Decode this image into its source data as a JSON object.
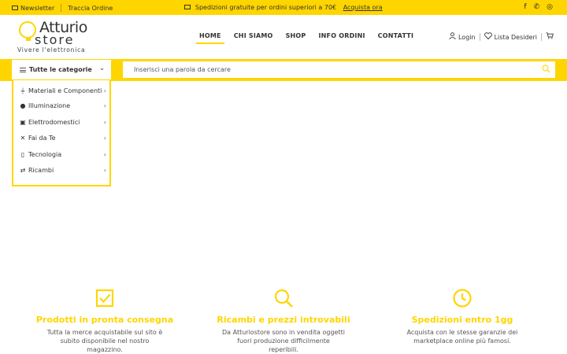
{
  "topbar": {
    "newsletter": "Newsletter",
    "track_order": "Traccia Ordine",
    "shipping_text": "Spedizioni gratuite per ordini superiori a 70€",
    "shipping_link": "Acquista ora",
    "social_icons": [
      "facebook-icon",
      "whatsapp-icon",
      "instagram-icon"
    ]
  },
  "logo": {
    "line1": "Atturio",
    "line2": "store",
    "tagline": "Vivere l'elettronica"
  },
  "nav": {
    "items": [
      "HOME",
      "CHI SIAMO",
      "SHOP",
      "INFO ORDINI",
      "CONTATTI"
    ],
    "active": "HOME"
  },
  "header_right": {
    "login": "Login",
    "wishlist": "Lista Desideri"
  },
  "search": {
    "categories_label": "Tutte le categorie",
    "placeholder": "Inserisci una parola da cercare"
  },
  "categories": [
    "Materiali e Componenti",
    "Illuminazione",
    "Elettrodomestici",
    "Fai da Te",
    "Tecnologia",
    "Ricambi"
  ],
  "features": [
    {
      "title": "Prodotti in pronta consegna",
      "desc": "Tutta la merce acquistabile sul sito è subito disponibile nel nostro magazzino."
    },
    {
      "title": "Ricambi e prezzi introvabili",
      "desc": "Da Atturiostore sono in vendita oggetti fuori produzione difficilmente reperibili."
    },
    {
      "title": "Spedizioni entro 1gg",
      "desc": "Acquista con le stesse garanzie dei marketplace online più famosi."
    }
  ],
  "colors": {
    "accent": "#ffd500",
    "text": "#333333"
  }
}
